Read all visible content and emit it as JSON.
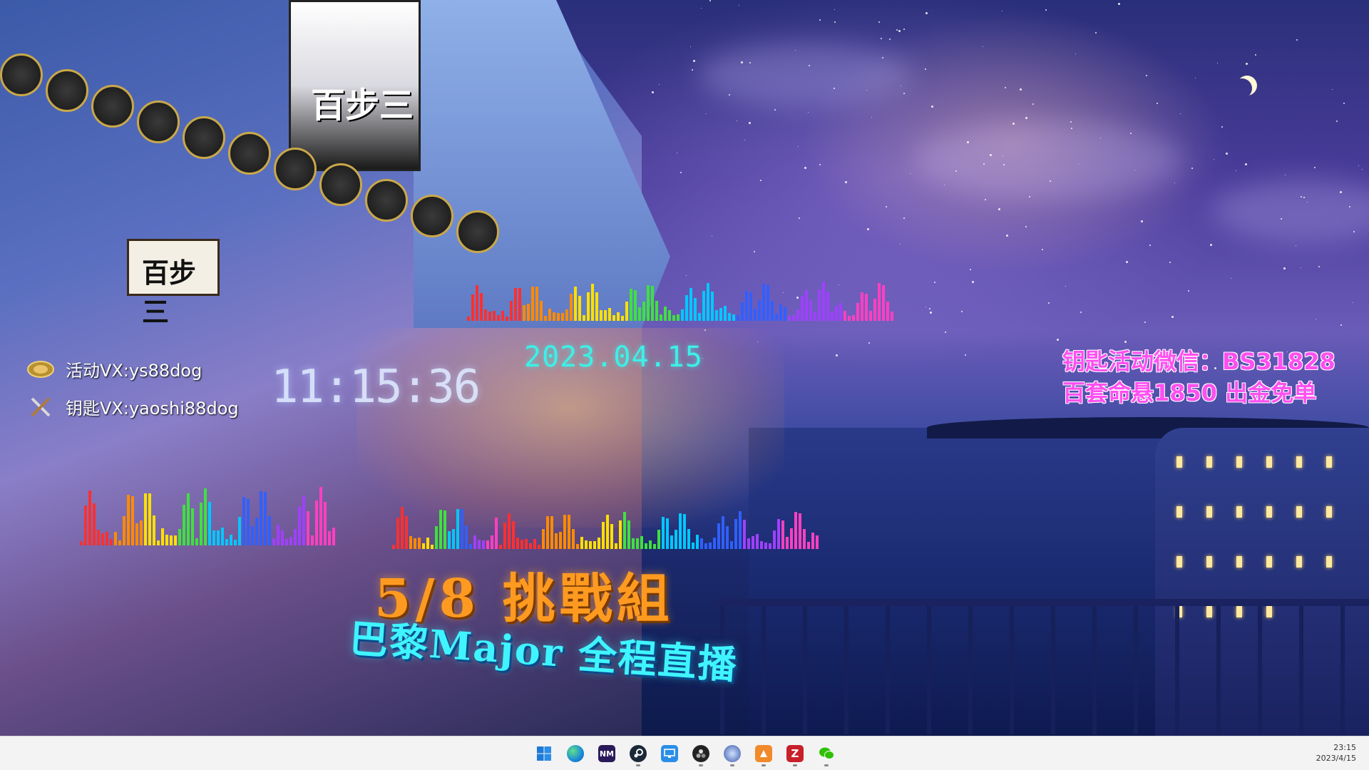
{
  "wallpaper": {
    "poster_text": "百步三",
    "shop_sign_text": "百步三"
  },
  "overlay": {
    "date": "2023.04.15",
    "time": "11:15:36",
    "contacts": [
      {
        "icon": "gold-coin-icon",
        "text": "活动VX:ys88dog"
      },
      {
        "icon": "crossed-tools-icon",
        "text": "钥匙VX:yaoshi88dog"
      }
    ],
    "promo_line1": "钥匙活动微信：BS31828",
    "promo_line2": "百套命悬1850 出金免单",
    "event_title": "5/8 挑戰組",
    "event_subtitle": "巴黎Major 全程直播"
  },
  "taskbar": {
    "apps": [
      {
        "name": "start-icon",
        "running": false
      },
      {
        "name": "edge-icon",
        "running": false
      },
      {
        "name": "visual-studio-icon",
        "running": false
      },
      {
        "name": "steam-icon",
        "running": true
      },
      {
        "name": "remote-desktop-icon",
        "running": false
      },
      {
        "name": "obs-icon",
        "running": true
      },
      {
        "name": "app-circle-icon",
        "running": true
      },
      {
        "name": "app-orange-icon",
        "running": true
      },
      {
        "name": "filezilla-icon",
        "running": true
      },
      {
        "name": "wechat-icon",
        "running": true
      }
    ],
    "clock_time": "23:15",
    "clock_date": "2023/4/15"
  },
  "colors": {
    "date": "#3df0e8",
    "promo": "#ff4ff0",
    "event_title": "#ff9a20",
    "event_subtitle": "#3ff4ff"
  }
}
